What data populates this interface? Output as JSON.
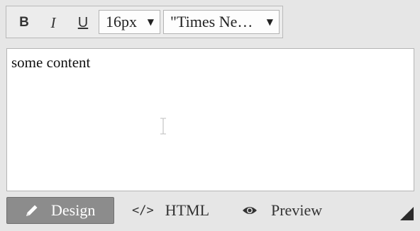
{
  "toolbar": {
    "bold_label": "B",
    "italic_label": "I",
    "underline_label": "U",
    "font_size": {
      "value": "16px",
      "arrow": "▼"
    },
    "font_family": {
      "value": "\"Times Ne…",
      "arrow": "▼"
    }
  },
  "editor": {
    "content": "some content"
  },
  "tabs": {
    "design": {
      "label": "Design",
      "icon": "pencil-icon",
      "active": true
    },
    "html": {
      "label": "HTML",
      "icon_text": "</>",
      "icon": "code-icon"
    },
    "preview": {
      "label": "Preview",
      "icon": "eye-icon"
    }
  },
  "colors": {
    "background": "#e6e6e6",
    "active_tab": "#8c8c8c",
    "editor_bg": "#ffffff"
  }
}
